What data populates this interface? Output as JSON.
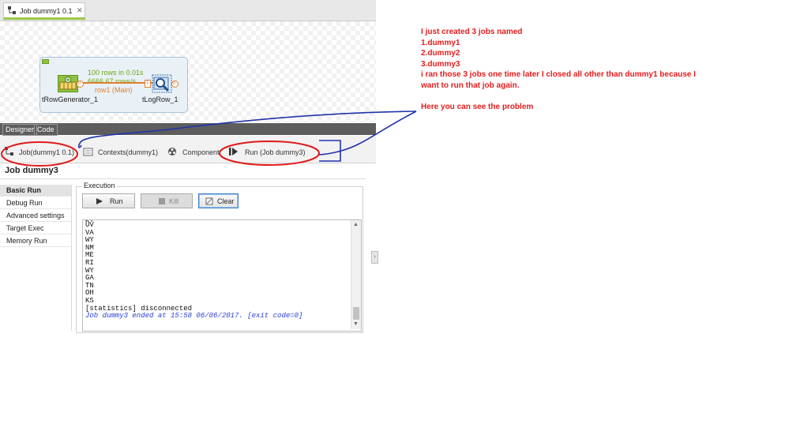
{
  "editor_tab": {
    "label": "Job dummy1 0.1",
    "close": "✕"
  },
  "canvas": {
    "stats_rows": "100 rows in 0.01s",
    "stats_rate": "6666.67 rows/s",
    "flow_label": "row1 (Main)",
    "generator_label": "tRowGenerator_1",
    "log_label": "tLogRow_1",
    "connector_out": "0",
    "connector_in": "1",
    "connector_log_out": "0"
  },
  "bottom_tabs": [
    {
      "label": "Designer"
    },
    {
      "label": "Code"
    }
  ],
  "view_tabs": [
    {
      "label": "Job(dummy1 0.1)"
    },
    {
      "label": "Contexts(dummy1)"
    },
    {
      "label": "Component"
    },
    {
      "label": "Run (Job dummy3)"
    }
  ],
  "run_view": {
    "title": "Job dummy3",
    "nav": [
      {
        "label": "Basic Run"
      },
      {
        "label": "Debug Run"
      },
      {
        "label": "Advanced settings"
      },
      {
        "label": "Target Exec"
      },
      {
        "label": "Memory Run"
      }
    ],
    "group_label": "Execution",
    "buttons": {
      "run": "Run",
      "kill": "Kill",
      "clear": "Clear"
    },
    "console_lines": [
      "UV",
      "VA",
      "WY",
      "NM",
      "ME",
      "RI",
      "WY",
      "GA",
      "TN",
      "OH",
      "KS",
      "[statistics] disconnected"
    ],
    "console_end": "Job dummy3 ended at 15:58 06/06/2017. [exit code=0]"
  },
  "note": {
    "lines": [
      "I just created 3 jobs named",
      "1.dummy1",
      "2.dummy2",
      "3.dummy3",
      "i ran those 3 jobs one time later I closed all other than dummy1 because I",
      "want to run that job again.",
      "",
      "Here you can see the problem"
    ],
    "color": "#e11d1d"
  },
  "colors": {
    "annotation_red": "#e01a1a",
    "annotation_blue": "#2233aa",
    "accent_green": "#8fc33f",
    "flow_orange": "#e07d2e"
  }
}
